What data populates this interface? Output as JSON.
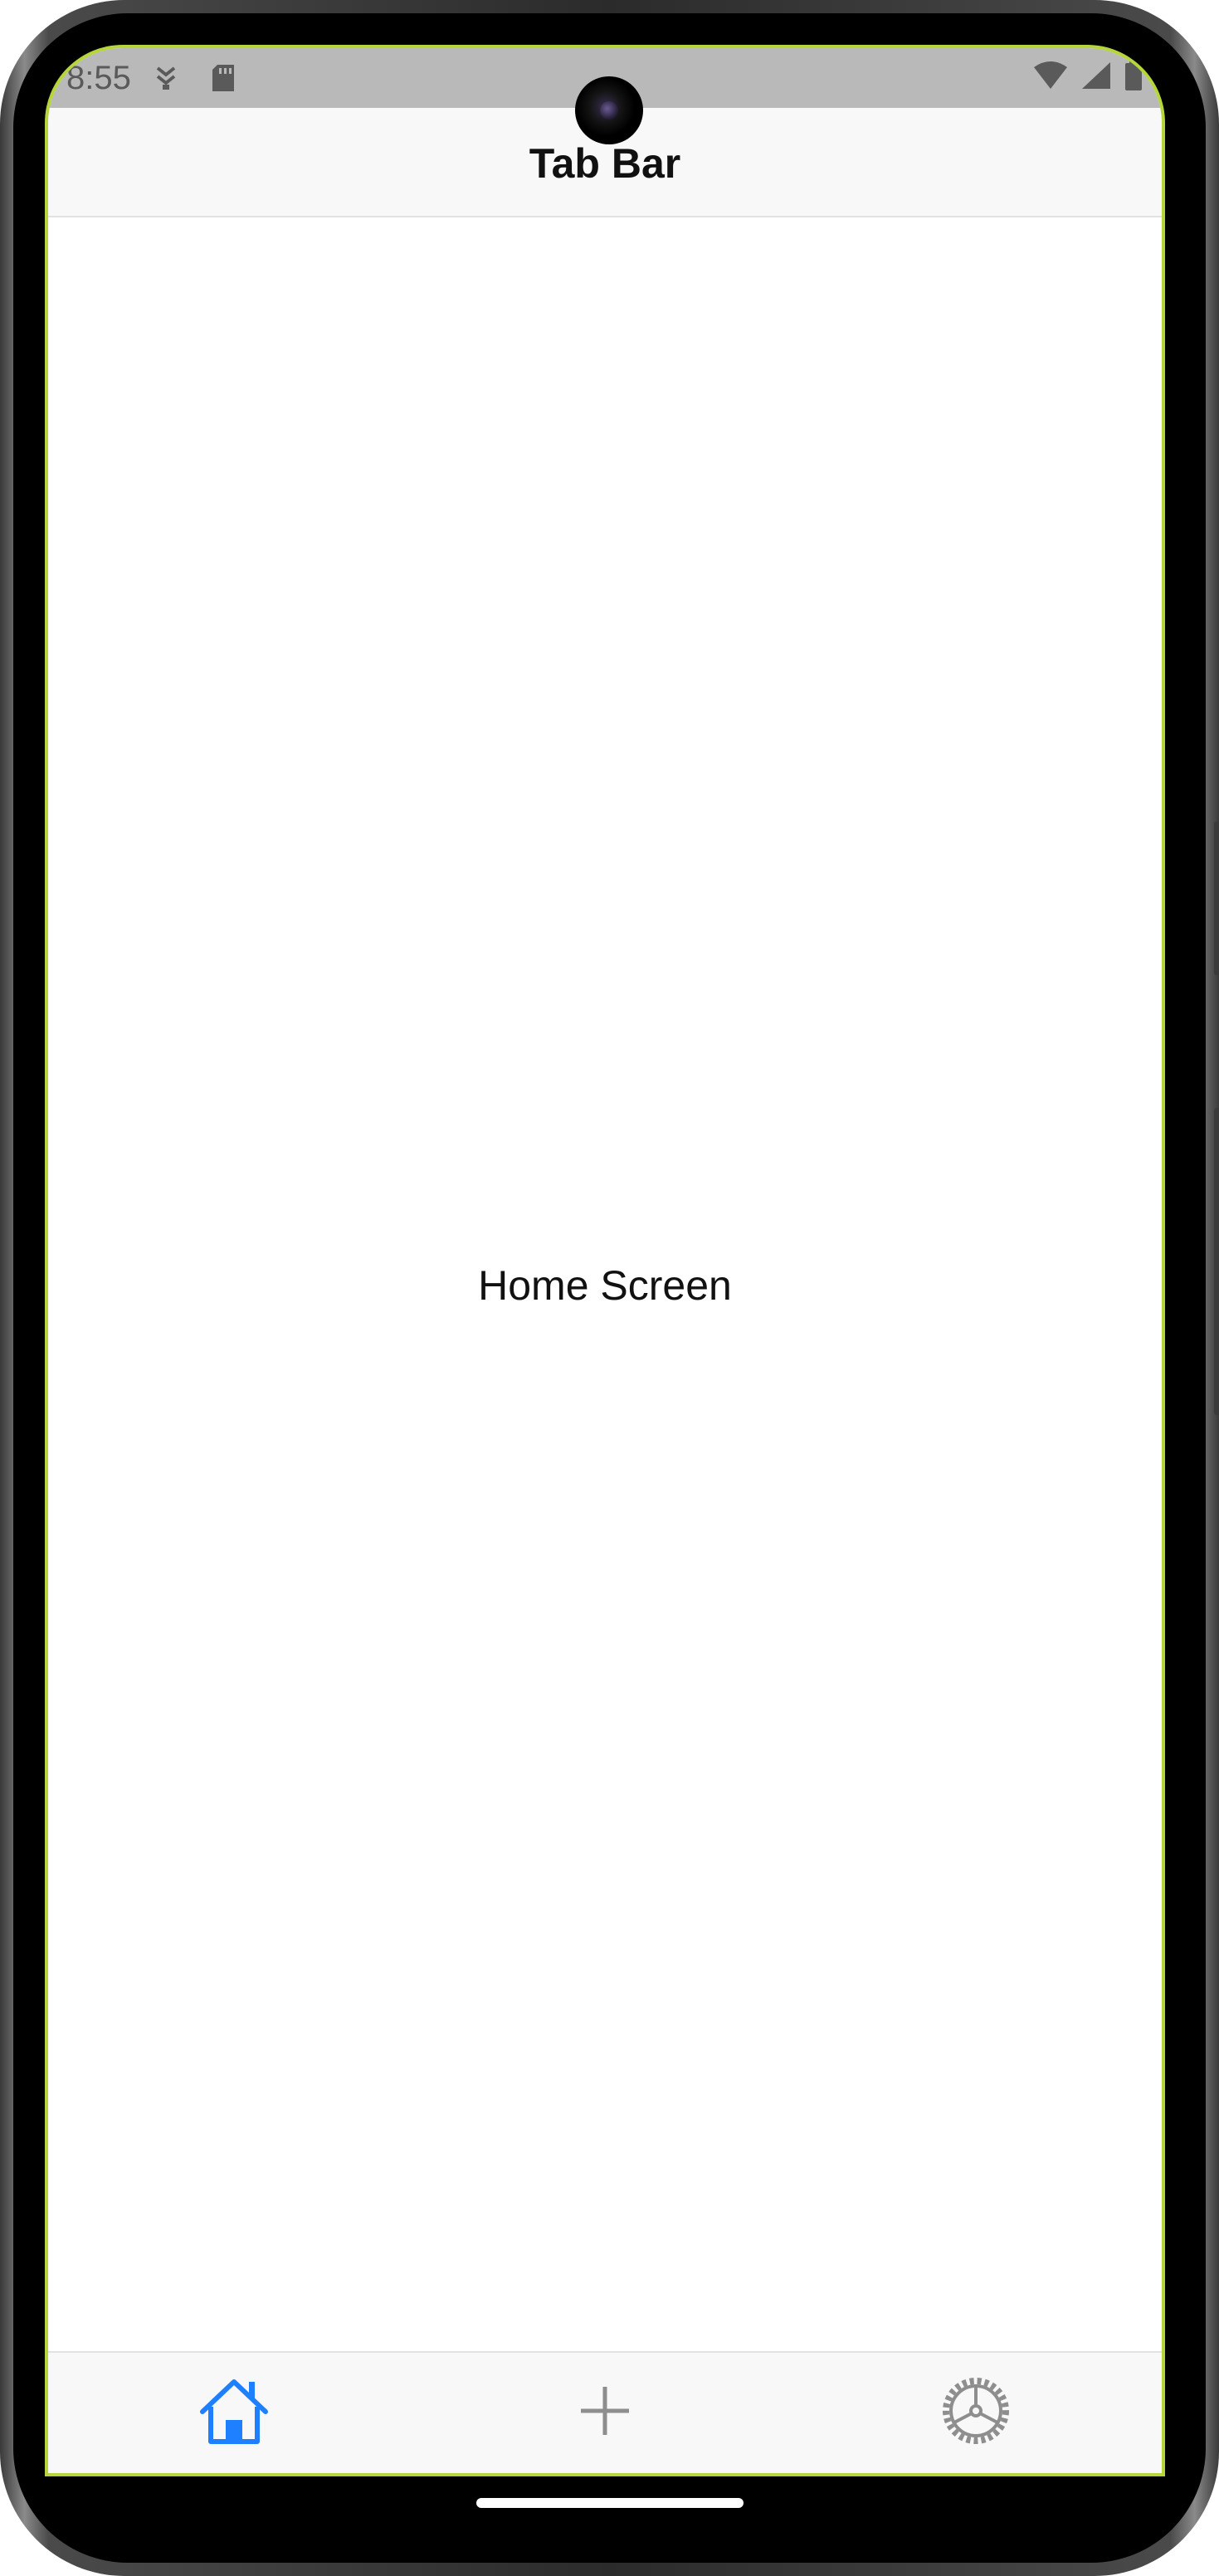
{
  "status_bar": {
    "time": "8:55",
    "icons": [
      "notification-icon",
      "sd-card-icon",
      "wifi-icon",
      "signal-icon",
      "battery-icon"
    ]
  },
  "header": {
    "title": "Tab Bar"
  },
  "main": {
    "text": "Home Screen"
  },
  "tab_bar": {
    "tabs": [
      {
        "icon": "home-icon",
        "active": true
      },
      {
        "icon": "plus-icon",
        "active": false
      },
      {
        "icon": "settings-gear-icon",
        "active": false
      }
    ]
  },
  "colors": {
    "accent": "#1E7FFF",
    "inactive": "#8E8E8E",
    "status_bar_bg": "#B9B9B9",
    "header_bg": "#F8F8F8"
  }
}
